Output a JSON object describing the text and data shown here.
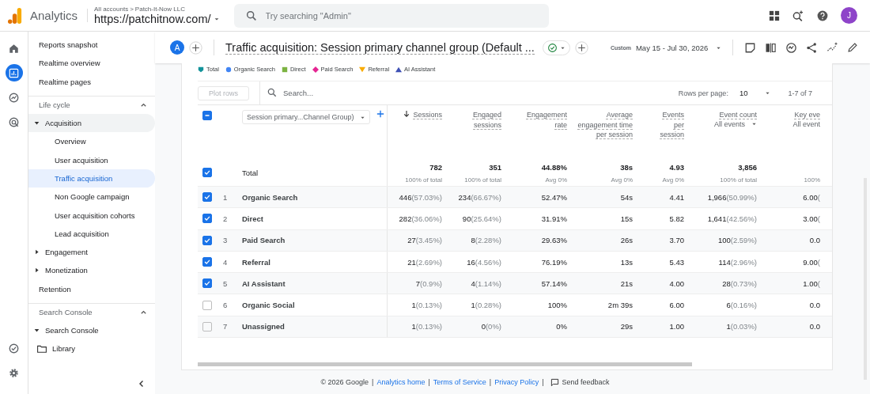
{
  "app": {
    "name": "Analytics",
    "breadcrumb_root": "All accounts",
    "breadcrumb_sep": ">",
    "account": "Patch-It-Now LLC",
    "property": "https://patchitnow.com/",
    "search_placeholder": "Try searching \"Admin\"",
    "avatar": "J"
  },
  "rail": [
    {
      "kind": "home",
      "selected": false
    },
    {
      "kind": "reports",
      "selected": true
    },
    {
      "kind": "explore",
      "selected": false
    },
    {
      "kind": "advertising",
      "selected": false
    }
  ],
  "rail_bottom": [
    {
      "kind": "admin"
    },
    {
      "kind": "settings"
    }
  ],
  "sidebar": {
    "items": [
      {
        "kind": "link",
        "label": "Reports snapshot",
        "selected": false
      },
      {
        "kind": "link",
        "label": "Realtime overview",
        "selected": false
      },
      {
        "kind": "link",
        "label": "Realtime pages",
        "selected": false
      },
      {
        "kind": "section",
        "label": "Life cycle",
        "expanded": true,
        "children": [
          {
            "kind": "group",
            "label": "Acquisition",
            "expanded": true,
            "selected": true,
            "children": [
              {
                "kind": "link",
                "label": "Overview",
                "selected": false
              },
              {
                "kind": "link",
                "label": "User acquisition",
                "selected": false
              },
              {
                "kind": "link",
                "label": "Traffic acquisition",
                "selected": true
              },
              {
                "kind": "link",
                "label": "Non Google campaign",
                "selected": false
              },
              {
                "kind": "link",
                "label": "User acquisition cohorts",
                "selected": false
              },
              {
                "kind": "link",
                "label": "Lead acquisition",
                "selected": false
              }
            ]
          },
          {
            "kind": "group",
            "label": "Engagement",
            "expanded": false,
            "selected": false
          },
          {
            "kind": "group",
            "label": "Monetization",
            "expanded": false,
            "selected": false
          },
          {
            "kind": "link",
            "label": "Retention",
            "selected": false
          }
        ]
      },
      {
        "kind": "section",
        "label": "Search Console",
        "expanded": true,
        "children": [
          {
            "kind": "group",
            "label": "Search Console",
            "expanded": true,
            "selected": false
          },
          {
            "kind": "folder",
            "label": "Library",
            "selected": false
          }
        ]
      }
    ]
  },
  "report": {
    "badge": "A",
    "title": "Traffic acquisition: Session primary channel group (Default ...",
    "compare_label": "Custom",
    "date_range": "May 15 - Jul 30, 2026"
  },
  "legend": [
    {
      "label": "Total",
      "kind": "pin",
      "color": "#12939a"
    },
    {
      "label": "Organic Search",
      "kind": "circle",
      "color": "#4285f4"
    },
    {
      "label": "Direct",
      "kind": "square",
      "color": "#7cb342"
    },
    {
      "label": "Paid Search",
      "kind": "diamond",
      "color": "#e52592"
    },
    {
      "label": "Referral",
      "kind": "triangle-down",
      "color": "#f9ab00"
    },
    {
      "label": "AI Assistant",
      "kind": "triangle",
      "color": "#3f51b5"
    }
  ],
  "table": {
    "plot_rows": "Plot rows",
    "search_placeholder": "Search...",
    "rows_per_page_label": "Rows per page:",
    "rows_per_page": "10",
    "pagination": "1-7 of 7",
    "header_partial": true,
    "dimension": "Session primary...Channel Group)",
    "total_label": "Total",
    "total_checked": true,
    "columns": [
      {
        "label": "Sessions",
        "sorted": true
      },
      {
        "label": "Engaged sessions",
        "sorted": false
      },
      {
        "label": "Engagement rate",
        "sorted": false
      },
      {
        "label": "Average engagement time per session",
        "sorted": false
      },
      {
        "label": "Events per session",
        "sorted": false
      },
      {
        "label": "Event count",
        "sublabel": "All events",
        "sorted": false
      },
      {
        "label": "Key eve",
        "sublabel": "All event",
        "sorted": false
      }
    ],
    "totals": [
      {
        "value": "782",
        "sub": "100% of total"
      },
      {
        "value": "351",
        "sub": "100% of total"
      },
      {
        "value": "44.88%",
        "sub": "Avg 0%"
      },
      {
        "value": "38s",
        "sub": "Avg 0%"
      },
      {
        "value": "4.93",
        "sub": "Avg 0%"
      },
      {
        "value": "3,856",
        "sub": "100% of total"
      },
      {
        "sub": "100%"
      }
    ],
    "rows": [
      {
        "rank": "1",
        "name": "Organic Search",
        "checked": true,
        "cells": [
          {
            "value": "446",
            "share": "(57.03%)"
          },
          {
            "value": "234",
            "share": "(66.67%)"
          },
          {
            "value": "52.47%"
          },
          {
            "value": "54s"
          },
          {
            "value": "4.41"
          },
          {
            "value": "1,966",
            "share": "(50.99%)"
          },
          {
            "value": "6.00",
            "share": "("
          }
        ]
      },
      {
        "rank": "2",
        "name": "Direct",
        "checked": true,
        "cells": [
          {
            "value": "282",
            "share": "(36.06%)"
          },
          {
            "value": "90",
            "share": "(25.64%)"
          },
          {
            "value": "31.91%"
          },
          {
            "value": "15s"
          },
          {
            "value": "5.82"
          },
          {
            "value": "1,641",
            "share": "(42.56%)"
          },
          {
            "value": "3.00",
            "share": "("
          }
        ]
      },
      {
        "rank": "3",
        "name": "Paid Search",
        "checked": true,
        "cells": [
          {
            "value": "27",
            "share": "(3.45%)"
          },
          {
            "value": "8",
            "share": "(2.28%)"
          },
          {
            "value": "29.63%"
          },
          {
            "value": "26s"
          },
          {
            "value": "3.70"
          },
          {
            "value": "100",
            "share": "(2.59%)"
          },
          {
            "value": "0.0"
          }
        ]
      },
      {
        "rank": "4",
        "name": "Referral",
        "checked": true,
        "cells": [
          {
            "value": "21",
            "share": "(2.69%)"
          },
          {
            "value": "16",
            "share": "(4.56%)"
          },
          {
            "value": "76.19%"
          },
          {
            "value": "13s"
          },
          {
            "value": "5.43"
          },
          {
            "value": "114",
            "share": "(2.96%)"
          },
          {
            "value": "9.00",
            "share": "("
          }
        ]
      },
      {
        "rank": "5",
        "name": "AI Assistant",
        "checked": true,
        "cells": [
          {
            "value": "7",
            "share": "(0.9%)"
          },
          {
            "value": "4",
            "share": "(1.14%)"
          },
          {
            "value": "57.14%"
          },
          {
            "value": "21s"
          },
          {
            "value": "4.00"
          },
          {
            "value": "28",
            "share": "(0.73%)"
          },
          {
            "value": "1.00",
            "share": "("
          }
        ]
      },
      {
        "rank": "6",
        "name": "Organic Social",
        "checked": false,
        "cells": [
          {
            "value": "1",
            "share": "(0.13%)"
          },
          {
            "value": "1",
            "share": "(0.28%)"
          },
          {
            "value": "100%"
          },
          {
            "value": "2m 39s"
          },
          {
            "value": "6.00"
          },
          {
            "value": "6",
            "share": "(0.16%)"
          },
          {
            "value": "0.0"
          }
        ]
      },
      {
        "rank": "7",
        "name": "Unassigned",
        "checked": false,
        "cells": [
          {
            "value": "1",
            "share": "(0.13%)"
          },
          {
            "value": "0",
            "share": "(0%)"
          },
          {
            "value": "0%"
          },
          {
            "value": "29s"
          },
          {
            "value": "1.00"
          },
          {
            "value": "1",
            "share": "(0.03%)"
          },
          {
            "value": "0.0"
          }
        ]
      }
    ]
  },
  "footer": [
    {
      "kind": "text",
      "label": "© 2026 Google"
    },
    {
      "kind": "separator",
      "label": "|"
    },
    {
      "kind": "link",
      "label": "Analytics home"
    },
    {
      "kind": "separator",
      "label": "|"
    },
    {
      "kind": "link",
      "label": "Terms of Service"
    },
    {
      "kind": "separator",
      "label": "|"
    },
    {
      "kind": "link",
      "label": "Privacy Policy"
    },
    {
      "kind": "separator",
      "label": "|"
    },
    {
      "kind": "feedback",
      "label": "Send feedback"
    }
  ]
}
